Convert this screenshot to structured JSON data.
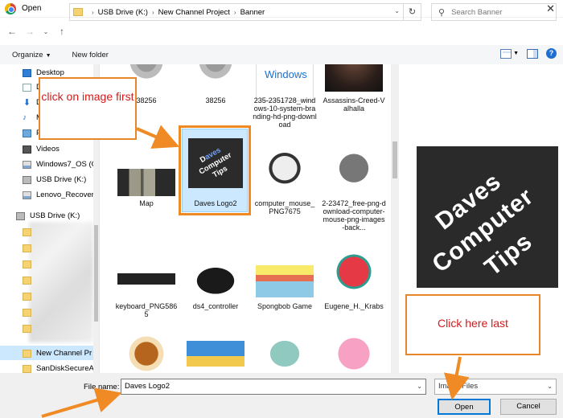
{
  "window": {
    "title": "Open",
    "close_glyph": "✕"
  },
  "address": {
    "crumbs": [
      "USB Drive (K:)",
      "New Channel Project",
      "Banner"
    ],
    "search_placeholder": "Search Banner"
  },
  "toolbar": {
    "organize_label": "Organize",
    "new_folder_label": "New folder"
  },
  "nav": {
    "items": [
      {
        "label": "Desktop",
        "icon": "desktop-icon"
      },
      {
        "label": "D",
        "icon": "documents-icon"
      },
      {
        "label": "D",
        "icon": "downloads-icon"
      },
      {
        "label": "M",
        "icon": "music-icon"
      },
      {
        "label": "P",
        "icon": "pictures-icon"
      },
      {
        "label": "Videos",
        "icon": "videos-icon"
      },
      {
        "label": "Windows7_OS (C",
        "icon": "drive-icon"
      },
      {
        "label": "USB Drive (K:)",
        "icon": "usb-drive-icon"
      },
      {
        "label": "Lenovo_Recover",
        "icon": "drive-icon"
      },
      {
        "label": "USB Drive (K:)",
        "icon": "usb-drive-icon"
      },
      {
        "label": "New Channel Pr",
        "icon": "folder-icon"
      },
      {
        "label": "SanDiskSecureA",
        "icon": "folder-icon"
      }
    ]
  },
  "files": [
    {
      "label": "38256",
      "icon": "statue-thumbnail"
    },
    {
      "label": "38256",
      "icon": "statue-thumbnail"
    },
    {
      "label": "235-2351728_windows-10-system-branding-hd-png-download",
      "icon": "windows-thumbnail",
      "thumb_text": "Windows"
    },
    {
      "label": "Assassins-Creed-Valhalla",
      "icon": "game-thumbnail"
    },
    {
      "label": "Map",
      "icon": "map-thumbnail"
    },
    {
      "label": "Daves Logo2",
      "icon": "logo-thumbnail"
    },
    {
      "label": "computer_mouse_PNG7675",
      "icon": "mouse-thumbnail"
    },
    {
      "label": "2-23472_free-png-download-computer-mouse-png-images-back...",
      "icon": "mouse-thumbnail"
    },
    {
      "label": "keyboard_PNG5865",
      "icon": "keyboard-thumbnail"
    },
    {
      "label": "ds4_controller",
      "icon": "controller-thumbnail"
    },
    {
      "label": "Spongbob Game",
      "icon": "game-thumbnail"
    },
    {
      "label": "Eugene_H._Krabs",
      "icon": "character-thumbnail"
    }
  ],
  "preview": {
    "words": [
      "Daves",
      "Computer",
      "Tips"
    ]
  },
  "bottom": {
    "file_name_label": "File name:",
    "file_name_value": "Daves Logo2",
    "filter_value": "Image Files",
    "open_label": "Open",
    "cancel_label": "Cancel"
  },
  "annotations": {
    "first": "click on image first",
    "last": "Click here last"
  },
  "colors": {
    "accent": "#0078d7",
    "callout_border": "#e8862a",
    "callout_text": "#d41a1a",
    "selection": "#cce8ff"
  }
}
